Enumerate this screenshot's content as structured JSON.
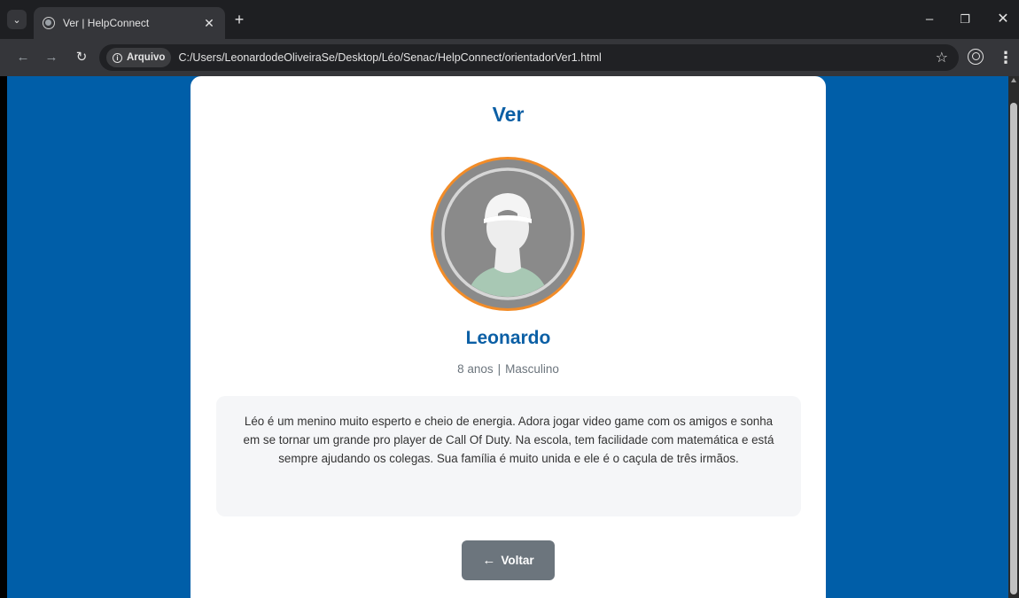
{
  "browser": {
    "tab_title": "Ver | HelpConnect",
    "tab_list_icon": "chevron-down-icon",
    "close_glyph": "✕",
    "new_tab_glyph": "+",
    "window": {
      "minimize": "–",
      "restore": "❐",
      "close": "✕"
    },
    "security_label": "Arquivo",
    "url": "C:/Users/LeonardodeOliveiraSe/Desktop/Léo/Senac/HelpConnect/orientadorVer1.html",
    "icons": [
      "back-arrow-icon",
      "forward-arrow-icon",
      "reload-icon",
      "info-icon",
      "star-icon",
      "profile-icon",
      "menu-icon"
    ]
  },
  "page": {
    "title": "Ver",
    "child": {
      "name": "Leonardo",
      "age": "8 anos",
      "separator": "|",
      "gender": "Masculino",
      "description": "Léo é um menino muito esperto e cheio de energia. Adora jogar video game com os amigos e sonha em se tornar um grande pro player de Call Of Duty. Na escola, tem facilidade com matemática e está sempre ajudando os colegas. Sua família é muito unida e ele é o caçula de três irmãos."
    },
    "back_button": {
      "arrow": "←",
      "label": "Voltar"
    }
  },
  "colors": {
    "background": "#005ea8",
    "title": "#0b5fa5",
    "avatar_ring": "#f28c28",
    "button": "#6c757d"
  }
}
